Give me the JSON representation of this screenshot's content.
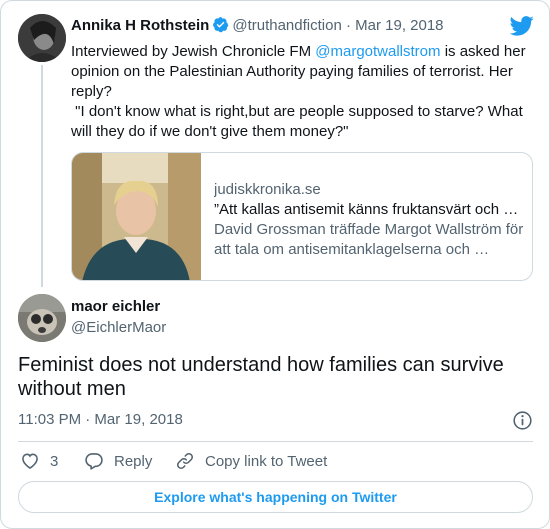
{
  "colors": {
    "accent": "#1d9bf0",
    "text_primary": "#0f1419",
    "text_secondary": "#536471",
    "border": "#cfd9de"
  },
  "quoted_tweet": {
    "author_name": "Annika H Rothstein",
    "verified_icon": "verified-badge-icon",
    "handle": "@truthandfiction",
    "separator": "·",
    "date": "Mar 19, 2018",
    "text_before_mention": "Interviewed by Jewish Chronicle FM ",
    "mention": "@margotwallstrom",
    "text_after_mention": " is asked her opinion on the Palestinian Authority paying families of terrorist. Her reply?",
    "quote": " \"I don't know what is right,but are people supposed to starve? What will they do if we don't give them money?\"",
    "link_card": {
      "domain": "judiskkronika.se",
      "title": "”Att kallas antisemit känns fruktansvärt och …",
      "description": "David Grossman träffade Margot Wallström för att tala om antisemitanklagelserna och …"
    }
  },
  "tweet": {
    "author_name": "maor eichler",
    "handle": "@EichlerMaor",
    "text": "Feminist does not understand how families can survive without men",
    "timestamp": "11:03 PM · Mar 19, 2018"
  },
  "actions": {
    "like_count": "3",
    "reply_label": "Reply",
    "copy_label": "Copy link to Tweet"
  },
  "explore_label": "Explore what's happening on Twitter",
  "icons": [
    "twitter-bird-icon",
    "verified-badge-icon",
    "info-icon",
    "heart-icon",
    "reply-icon",
    "link-icon"
  ]
}
